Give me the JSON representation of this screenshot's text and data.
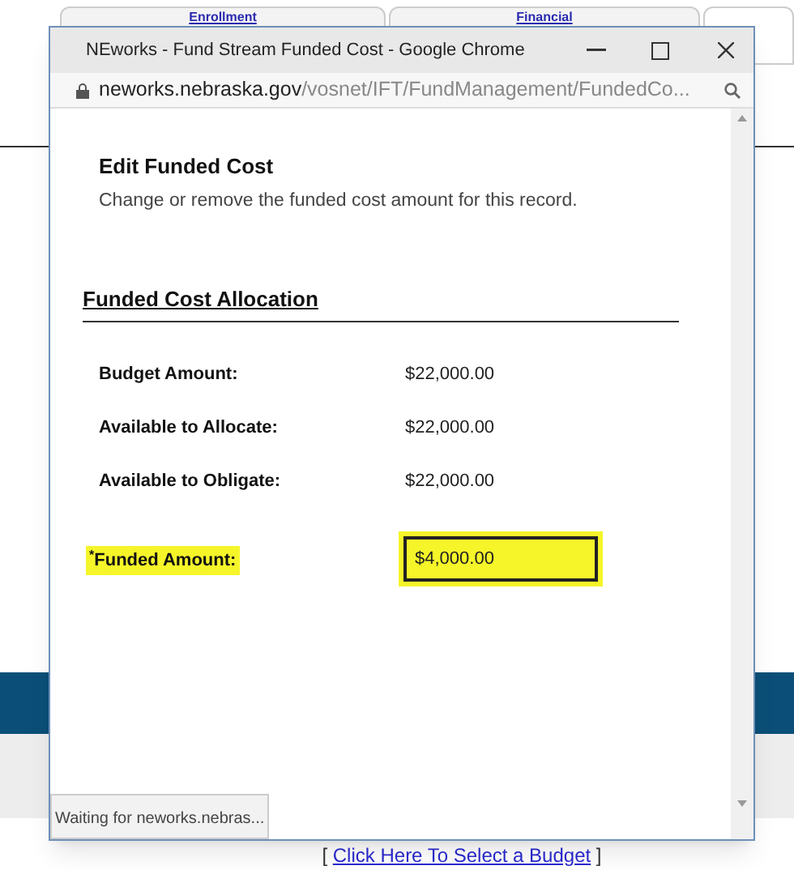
{
  "background": {
    "tabs": [
      {
        "label": "Enrollment"
      },
      {
        "label": "Financial"
      }
    ],
    "link": {
      "open_bracket": "[",
      "text": "Click Here To Select a Budget",
      "close_bracket": "]"
    }
  },
  "window": {
    "title": "NEworks - Fund Stream Funded Cost - Google Chrome",
    "address": {
      "domain": "neworks.nebraska.gov",
      "path": "/vosnet/IFT/FundManagement/FundedCo..."
    },
    "status": "Waiting for neworks.nebras..."
  },
  "page": {
    "heading": "Edit Funded Cost",
    "description": "Change or remove the funded cost amount for this record.",
    "section_title": "Funded Cost Allocation",
    "rows": [
      {
        "label": "Budget Amount:",
        "value": "$22,000.00"
      },
      {
        "label": "Available to Allocate:",
        "value": "$22,000.00"
      },
      {
        "label": "Available to Obligate:",
        "value": "$22,000.00"
      }
    ],
    "funded": {
      "required_mark": "*",
      "label": "Funded Amount:",
      "value": "$4,000.00",
      "highlighted": true
    }
  }
}
